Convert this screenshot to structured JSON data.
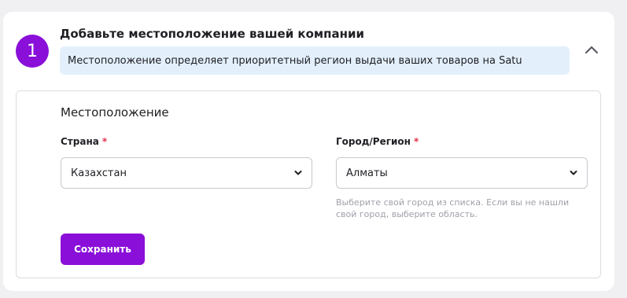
{
  "step": {
    "number": "1",
    "title": "Добавьте местоположение вашей компании",
    "info": "Местоположение определяет приоритетный регион выдачи ваших товаров на Satu"
  },
  "colors": {
    "accent": "#8a0fd9",
    "info_background": "#e3f0fc",
    "required": "#e0314b",
    "hint_text": "#a0a0aa"
  },
  "icons": {
    "collapse": "chevron-up-icon",
    "select": "chevron-down-icon"
  },
  "location": {
    "section_title": "Местоположение",
    "country": {
      "label": "Страна",
      "required_mark": "*",
      "value": "Казахстан"
    },
    "city": {
      "label": "Город/Регион",
      "required_mark": "*",
      "value": "Алматы",
      "hint": "Выберите свой город из списка. Если вы не нашли свой город, выберите область."
    },
    "save_label": "Сохранить"
  }
}
